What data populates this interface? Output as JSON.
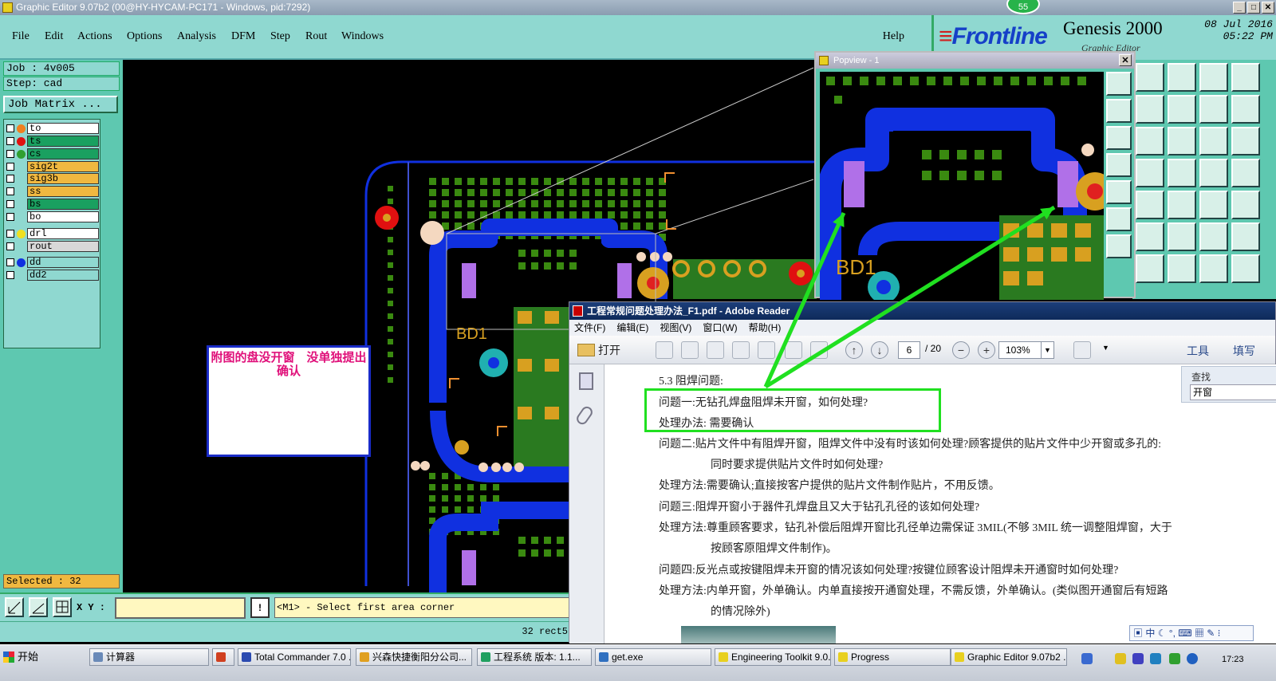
{
  "window": {
    "title": "Graphic Editor 9.07b2 (00@HY-HYCAM-PC171 - Windows, pid:7292)",
    "badge": "55"
  },
  "menu": [
    {
      "label": "File"
    },
    {
      "label": "Edit"
    },
    {
      "label": "Actions"
    },
    {
      "label": "Options"
    },
    {
      "label": "Analysis"
    },
    {
      "label": "DFM"
    },
    {
      "label": "Step"
    },
    {
      "label": "Rout"
    },
    {
      "label": "Windows"
    }
  ],
  "help_label": "Help",
  "brand": {
    "logo": "Frontline",
    "product": "Genesis 2000",
    "subtitle": "Graphic Editor",
    "date": "08 Jul 2016",
    "time": "05:22 PM"
  },
  "job": {
    "job_label": "Job : 4v005",
    "step_label": "Step: cad",
    "matrix_button": "Job Matrix ..."
  },
  "layers": [
    {
      "name": "to",
      "dot": "#f08020",
      "bg": "#ffffff"
    },
    {
      "name": "ts",
      "dot": "#e01010",
      "bg": "#1aa060"
    },
    {
      "name": "cs",
      "dot": "#30a030",
      "bg": "#1aa060"
    },
    {
      "name": "sig2t",
      "dot": "",
      "bg": "#f0b840"
    },
    {
      "name": "sig3b",
      "dot": "",
      "bg": "#f0b840"
    },
    {
      "name": "ss",
      "dot": "",
      "bg": "#f0b840"
    },
    {
      "name": "bs",
      "dot": "",
      "bg": "#1aa060"
    },
    {
      "name": "bo",
      "dot": "",
      "bg": "#ffffff"
    },
    {
      "name": "drl",
      "dot": "#f0e020",
      "bg": "#ffffff"
    },
    {
      "name": "rout",
      "dot": "",
      "bg": "#d8d8d8"
    },
    {
      "name": "dd",
      "dot": "#1030e0",
      "bg": "#8fd8d0"
    },
    {
      "name": "dd2",
      "dot": "",
      "bg": "#8fd8d0"
    }
  ],
  "selected_text": "Selected : 32",
  "canvas": {
    "ref_label": "BD1",
    "note": "附图的盘没开窗　没单独提出确认"
  },
  "command": {
    "xy_label": "X Y :",
    "xy_value": "",
    "message": "<M1> - Select first area corner",
    "status": "32 rect5"
  },
  "popview": {
    "title": "Popview - 1",
    "ref_label": "BD1"
  },
  "reader": {
    "title": "工程常规问题处理办法_F1.pdf - Adobe Reader",
    "menu": [
      "文件(F)",
      "编辑(E)",
      "视图(V)",
      "窗口(W)",
      "帮助(H)"
    ],
    "open_label": "打开",
    "page": "6",
    "total": "/ 20",
    "zoom": "103%",
    "tools_label": "工具",
    "fill_label": "填写",
    "search_label": "查找",
    "search_value": "开窗",
    "ime_text": "中",
    "lines": [
      "5.3 阻焊问题:",
      "问题一:无钻孔焊盘阻焊未开窗，如何处理?",
      "处理办法: 需要确认",
      "问题二:贴片文件中有阻焊开窗，阻焊文件中没有时该如何处理?顾客提供的贴片文件中少开窗或多孔的:",
      "同时要求提供贴片文件时如何处理?",
      "处理方法:需要确认;直接按客户提供的贴片文件制作贴片，不用反馈。",
      "问题三:阻焊开窗小于器件孔焊盘且又大于钻孔孔径的该如何处理?",
      "处理方法:尊重顾客要求，钻孔补偿后阻焊开窗比孔径单边需保证 3MIL(不够 3MIL 统一调整阻焊窗，大于",
      "按顾客原阻焊文件制作)。",
      "问题四:反光点或按键阻焊未开窗的情况该如何处理?按键位顾客设计阻焊未开通窗时如何处理?",
      "处理方法:内单开窗，外单确认。内单直接按开通窗处理，不需反馈，外单确认。(类似图开通窗后有短路",
      "的情况除外)"
    ]
  },
  "taskbar": {
    "start": "开始",
    "tasks": [
      {
        "label": "计算器",
        "color": "#6a8ab8"
      },
      {
        "label": "",
        "color": "#d04020"
      },
      {
        "label": "Total Commander 7.0 ...",
        "color": "#2a4ab0"
      },
      {
        "label": "兴森快捷衡阳分公司...",
        "color": "#e0a020"
      },
      {
        "label": "工程系统  版本: 1.1...",
        "color": "#20a060"
      },
      {
        "label": "get.exe",
        "color": "#3070c0"
      },
      {
        "label": "Engineering Toolkit 9.0...",
        "color": "#e8d020"
      },
      {
        "label": "Progress",
        "color": "#e8d020"
      },
      {
        "label": "Graphic Editor 9.07b2 ...",
        "color": "#e8d020"
      }
    ],
    "clock": "17:23"
  },
  "colors": {
    "board_blue": "#1030e0",
    "pad_green": "#3a8a10",
    "copper": "#d8a020",
    "annotation": "#20e020"
  }
}
